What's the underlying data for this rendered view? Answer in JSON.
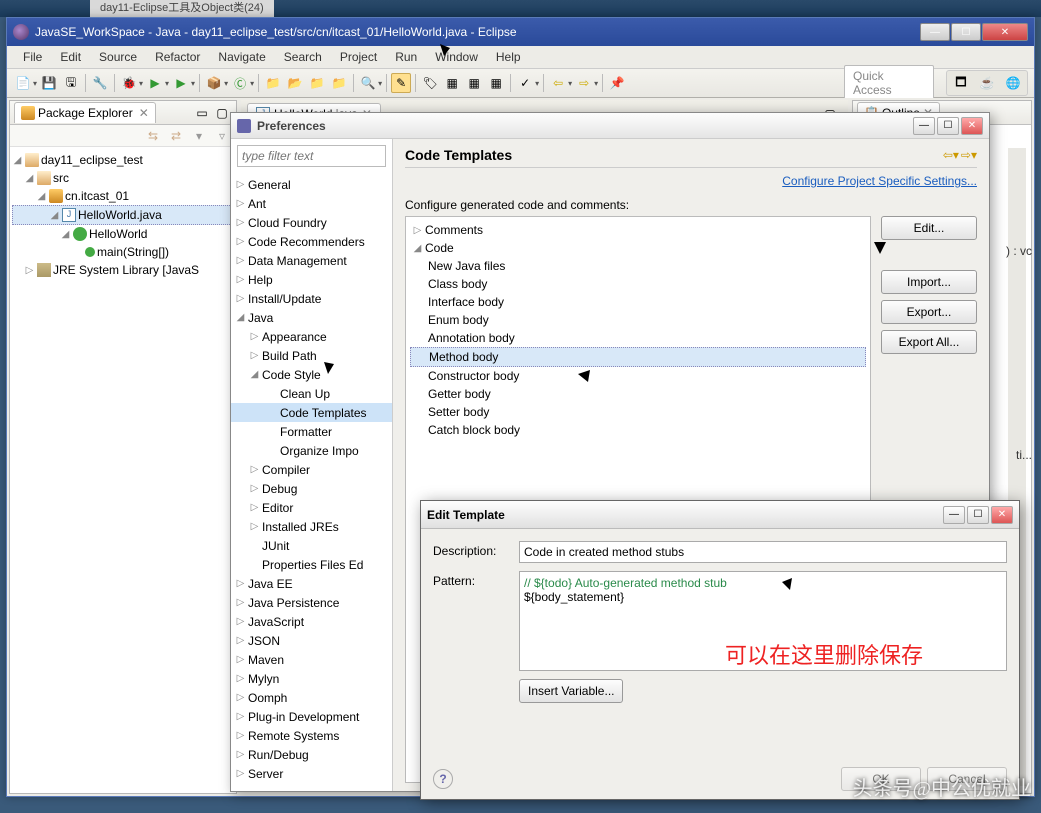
{
  "browser_tab": "day11-Eclipse工具及Object类(24)",
  "window": {
    "title": "JavaSE_WorkSpace - Java - day11_eclipse_test/src/cn/itcast_01/HelloWorld.java - Eclipse"
  },
  "menu": [
    "File",
    "Edit",
    "Source",
    "Refactor",
    "Navigate",
    "Search",
    "Project",
    "Run",
    "Window",
    "Help"
  ],
  "quick_access": "Quick Access",
  "pkg_explorer": {
    "title": "Package Explorer",
    "items": {
      "project": "day11_eclipse_test",
      "src": "src",
      "pkg": "cn.itcast_01",
      "file": "HelloWorld.java",
      "cls": "HelloWorld",
      "method": "main(String[])",
      "lib": "JRE System Library [JavaS"
    }
  },
  "editor_tab": "HelloWorld.java",
  "outline": {
    "title": "Outline"
  },
  "right_frag": ") : vc",
  "right_frag2": "ti...",
  "preferences": {
    "title": "Preferences",
    "filter_placeholder": "type filter text",
    "tree": [
      {
        "l": "General",
        "exp": "▷"
      },
      {
        "l": "Ant",
        "exp": "▷"
      },
      {
        "l": "Cloud Foundry",
        "exp": "▷"
      },
      {
        "l": "Code Recommenders",
        "exp": "▷"
      },
      {
        "l": "Data Management",
        "exp": "▷"
      },
      {
        "l": "Help",
        "exp": "▷"
      },
      {
        "l": "Install/Update",
        "exp": "▷"
      },
      {
        "l": "Java",
        "exp": "◢",
        "children": [
          {
            "l": "Appearance",
            "exp": "▷"
          },
          {
            "l": "Build Path",
            "exp": "▷"
          },
          {
            "l": "Code Style",
            "exp": "◢",
            "children": [
              {
                "l": "Clean Up"
              },
              {
                "l": "Code Templates",
                "sel": true
              },
              {
                "l": "Formatter"
              },
              {
                "l": "Organize Impo"
              }
            ]
          },
          {
            "l": "Compiler",
            "exp": "▷"
          },
          {
            "l": "Debug",
            "exp": "▷"
          },
          {
            "l": "Editor",
            "exp": "▷"
          },
          {
            "l": "Installed JREs",
            "exp": "▷"
          },
          {
            "l": "JUnit"
          },
          {
            "l": "Properties Files Ed"
          }
        ]
      },
      {
        "l": "Java EE",
        "exp": "▷"
      },
      {
        "l": "Java Persistence",
        "exp": "▷"
      },
      {
        "l": "JavaScript",
        "exp": "▷"
      },
      {
        "l": "JSON",
        "exp": "▷"
      },
      {
        "l": "Maven",
        "exp": "▷"
      },
      {
        "l": "Mylyn",
        "exp": "▷"
      },
      {
        "l": "Oomph",
        "exp": "▷"
      },
      {
        "l": "Plug-in Development",
        "exp": "▷"
      },
      {
        "l": "Remote Systems",
        "exp": "▷"
      },
      {
        "l": "Run/Debug",
        "exp": "▷"
      },
      {
        "l": "Server",
        "exp": "▷"
      }
    ],
    "page": {
      "heading": "Code Templates",
      "link": "Configure Project Specific Settings...",
      "desc": "Configure generated code and comments:",
      "tree": {
        "comments": "Comments",
        "code": "Code",
        "items": [
          "New Java files",
          "Class body",
          "Interface body",
          "Enum body",
          "Annotation body",
          "Method body",
          "Constructor body",
          "Getter body",
          "Setter body",
          "Catch block body"
        ]
      },
      "buttons": {
        "edit": "Edit...",
        "import": "Import...",
        "export": "Export...",
        "export_all": "Export All..."
      }
    }
  },
  "edit_template": {
    "title": "Edit Template",
    "desc_label": "Description:",
    "desc_value": "Code in created method stubs",
    "pattern_label": "Pattern:",
    "pattern_comment": "// ${todo} Auto-generated method stub",
    "pattern_line2": "${body_statement}",
    "insert_var": "Insert Variable...",
    "ok": "OK",
    "cancel": "Cancel"
  },
  "red_note": "可以在这里删除保存",
  "watermark": "头条号@中公优就业"
}
